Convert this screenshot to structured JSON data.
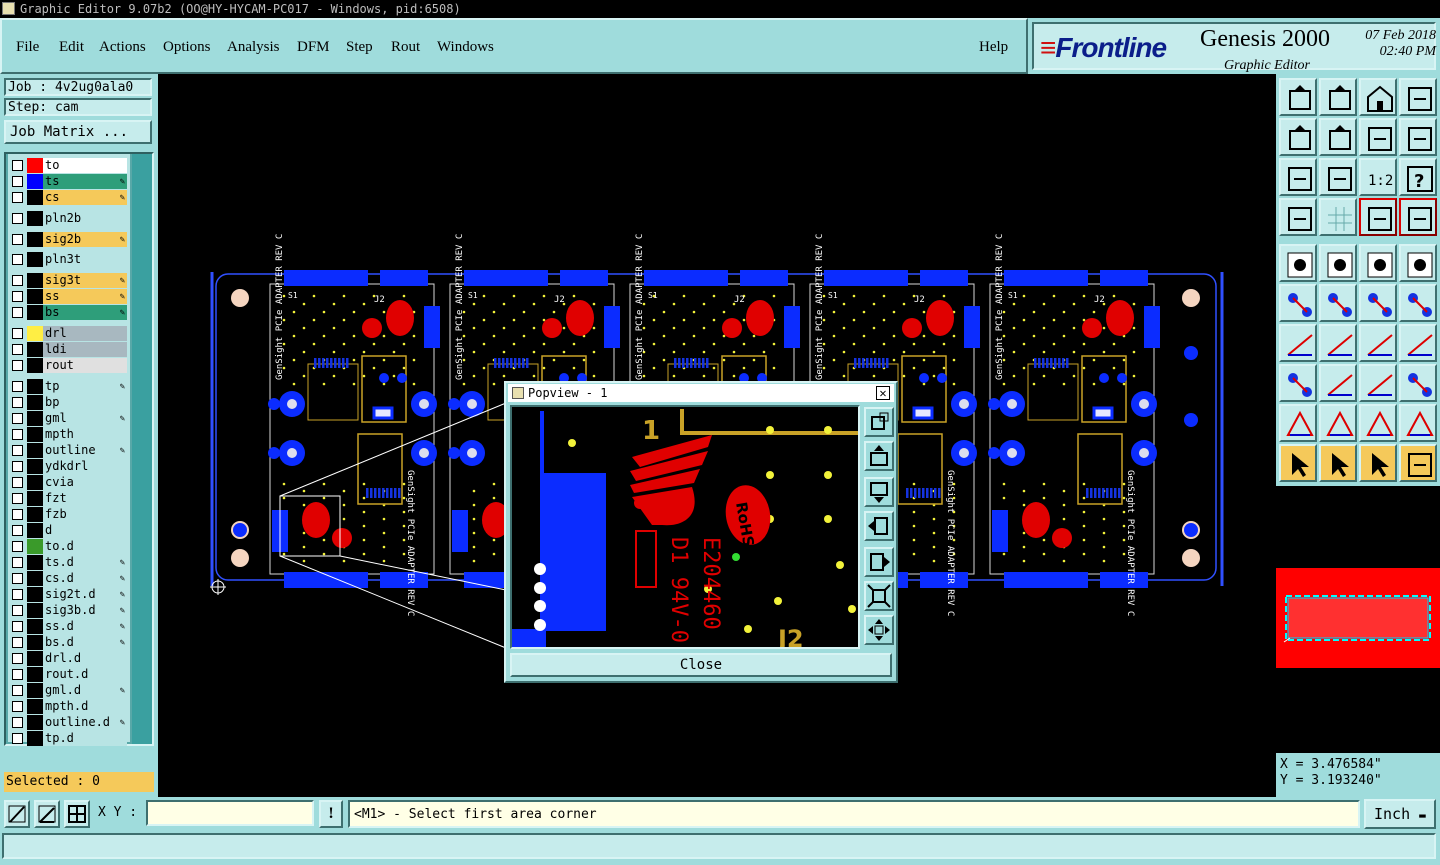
{
  "window": {
    "title": "Graphic Editor 9.07b2 (OO@HY-HYCAM-PC017 - Windows, pid:6508)"
  },
  "menu": {
    "items": [
      {
        "label": "File"
      },
      {
        "label": "Edit"
      },
      {
        "label": "Actions"
      },
      {
        "label": "Options"
      },
      {
        "label": "Analysis"
      },
      {
        "label": "DFM"
      },
      {
        "label": "Step"
      },
      {
        "label": "Rout"
      },
      {
        "label": "Windows"
      }
    ],
    "help": "Help"
  },
  "brand": {
    "logo": "Frontline",
    "product": "Genesis 2000",
    "subtitle": "Graphic Editor",
    "date": "07 Feb 2018",
    "time": "02:40 PM"
  },
  "job": {
    "job_line": "Job : 4v2ug0ala0",
    "step_line": "Step: cam",
    "matrix_button": "Job Matrix ..."
  },
  "layers": [
    {
      "name": "to",
      "swatch": "#ff0000",
      "name_bg": "#ffffff",
      "editable": false,
      "row": 0
    },
    {
      "name": "ts",
      "swatch": "#0000ff",
      "name_bg": "#2e9e7a",
      "editable": true,
      "row": 1
    },
    {
      "name": "cs",
      "swatch": "",
      "name_bg": "#f5c95a",
      "editable": true,
      "row": 2
    },
    {
      "name": "pln2b",
      "swatch": "",
      "name_bg": "#b8e4e4",
      "editable": false,
      "row": 3.3
    },
    {
      "name": "sig2b",
      "swatch": "",
      "name_bg": "#f5c95a",
      "editable": true,
      "row": 4.6
    },
    {
      "name": "pln3t",
      "swatch": "",
      "name_bg": "#b8e4e4",
      "editable": false,
      "row": 5.9
    },
    {
      "name": "sig3t",
      "swatch": "",
      "name_bg": "#f5c95a",
      "editable": true,
      "row": 7.2
    },
    {
      "name": "ss",
      "swatch": "",
      "name_bg": "#f5c95a",
      "editable": true,
      "row": 8.2
    },
    {
      "name": "bs",
      "swatch": "",
      "name_bg": "#2e9e7a",
      "editable": true,
      "row": 9.2
    },
    {
      "name": "drl",
      "swatch": "#ffee44",
      "name_bg": "#a8b8c0",
      "editable": false,
      "row": 10.5
    },
    {
      "name": "ldi",
      "swatch": "",
      "name_bg": "#a8b8c0",
      "editable": false,
      "row": 11.5
    },
    {
      "name": "rout",
      "swatch": "",
      "name_bg": "#e0e0e0",
      "editable": false,
      "row": 12.5
    },
    {
      "name": "tp",
      "swatch": "",
      "name_bg": "#b8e4e4",
      "editable": true,
      "row": 13.8
    },
    {
      "name": "bp",
      "swatch": "",
      "name_bg": "#b8e4e4",
      "editable": false,
      "row": 14.8
    },
    {
      "name": "gml",
      "swatch": "",
      "name_bg": "#b8e4e4",
      "editable": true,
      "row": 15.8
    },
    {
      "name": "mpth",
      "swatch": "",
      "name_bg": "#b8e4e4",
      "editable": false,
      "row": 16.8
    },
    {
      "name": "outline",
      "swatch": "",
      "name_bg": "#b8e4e4",
      "editable": true,
      "row": 17.8
    },
    {
      "name": "ydkdrl",
      "swatch": "",
      "name_bg": "#b8e4e4",
      "editable": false,
      "row": 18.8
    },
    {
      "name": "cvia",
      "swatch": "",
      "name_bg": "#b8e4e4",
      "editable": false,
      "row": 19.8
    },
    {
      "name": "fzt",
      "swatch": "",
      "name_bg": "#b8e4e4",
      "editable": false,
      "row": 20.8
    },
    {
      "name": "fzb",
      "swatch": "",
      "name_bg": "#b8e4e4",
      "editable": false,
      "row": 21.8
    },
    {
      "name": "d",
      "swatch": "",
      "name_bg": "#b8e4e4",
      "editable": false,
      "row": 22.8
    },
    {
      "name": "to.d",
      "swatch": "#3a9a2a",
      "name_bg": "#b8e4e4",
      "editable": false,
      "row": 23.8
    },
    {
      "name": "ts.d",
      "swatch": "",
      "name_bg": "#b8e4e4",
      "editable": true,
      "row": 24.8
    },
    {
      "name": "cs.d",
      "swatch": "",
      "name_bg": "#b8e4e4",
      "editable": true,
      "row": 25.8
    },
    {
      "name": "sig2t.d",
      "swatch": "",
      "name_bg": "#b8e4e4",
      "editable": true,
      "row": 26.8
    },
    {
      "name": "sig3b.d",
      "swatch": "",
      "name_bg": "#b8e4e4",
      "editable": true,
      "row": 27.8
    },
    {
      "name": "ss.d",
      "swatch": "",
      "name_bg": "#b8e4e4",
      "editable": true,
      "row": 28.8
    },
    {
      "name": "bs.d",
      "swatch": "",
      "name_bg": "#b8e4e4",
      "editable": true,
      "row": 29.8
    },
    {
      "name": "drl.d",
      "swatch": "",
      "name_bg": "#b8e4e4",
      "editable": false,
      "row": 30.8
    },
    {
      "name": "rout.d",
      "swatch": "",
      "name_bg": "#b8e4e4",
      "editable": false,
      "row": 31.8
    },
    {
      "name": "gml.d",
      "swatch": "",
      "name_bg": "#b8e4e4",
      "editable": true,
      "row": 32.8
    },
    {
      "name": "mpth.d",
      "swatch": "",
      "name_bg": "#b8e4e4",
      "editable": false,
      "row": 33.8
    },
    {
      "name": "outline.d",
      "swatch": "",
      "name_bg": "#b8e4e4",
      "editable": true,
      "row": 34.8
    },
    {
      "name": "tp.d",
      "swatch": "",
      "name_bg": "#b8e4e4",
      "editable": false,
      "row": 35.8
    }
  ],
  "selected": "Selected : 0",
  "popview": {
    "title": "Popview - 1",
    "close": "Close",
    "board_text": [
      "E204460",
      "D1 94V-0",
      "RoHS",
      "J2",
      "1"
    ]
  },
  "board": {
    "labels": [
      "GenSight PCIe ADAPTER REV C",
      "J2",
      "S1",
      "P1",
      "J6"
    ]
  },
  "right_tools": {
    "icons": [
      "view-all-icon",
      "zoom-window-icon",
      "home-icon",
      "split-view-icon",
      "pan-left-icon",
      "pan-right-icon",
      "undo-view-icon",
      "redraw-icon",
      "fit-screen-icon",
      "center-icon",
      "scale-1-2-icon",
      "help-icon",
      "measure-icon",
      "grid-icon",
      "snap-icon",
      "connect-icon",
      "select-feature-icon",
      "net-icon",
      "ruler-icon",
      "pad-icon",
      "add-pad-icon",
      "cross-icon",
      "move-icon",
      "add-line-icon",
      "angle-icon",
      "line-icon",
      "arc-icon",
      "mirror-icon",
      "copy-icon",
      "stretch-icon",
      "resize-icon",
      "polygon-icon",
      "triangle-icon",
      "delta-icon",
      "arch-icon",
      "arch-edit-icon",
      "pointer-icon",
      "select-pointer-icon",
      "select-box-icon",
      "route-icon"
    ],
    "scale_label": "1:2"
  },
  "coords": {
    "x": "X = 3.476584\"",
    "y": "Y = 3.193240\""
  },
  "bottom": {
    "xy_label": "X Y :",
    "xy_value": "",
    "status": "<M1> - Select first area corner",
    "unit": "Inch"
  },
  "colors": {
    "panel": "#9fdcdc",
    "field": "#c6ecec",
    "highlight": "#f5c95a",
    "copper_blue": "#0b2cff",
    "silk_red": "#e00000",
    "overview_red": "#ff0000"
  }
}
